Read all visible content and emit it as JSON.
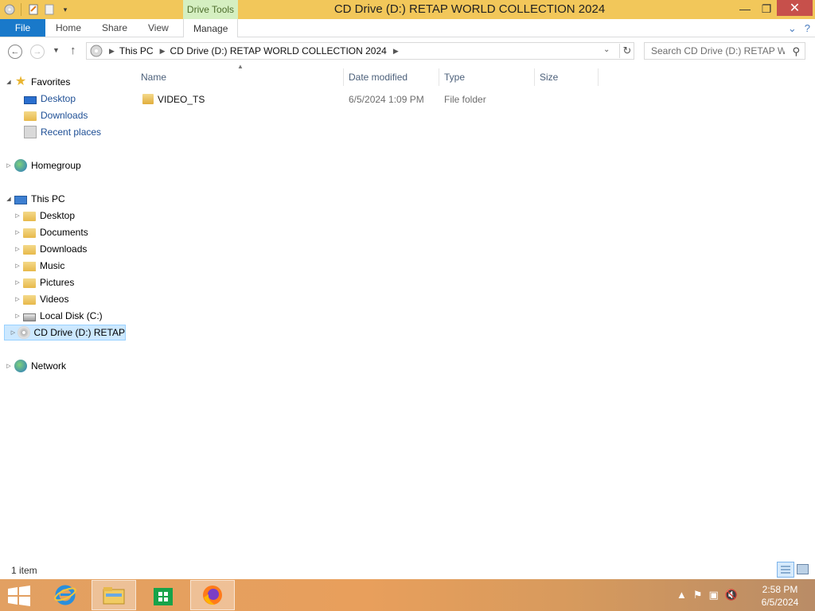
{
  "window": {
    "title": "CD Drive (D:) RETAP WORLD COLLECTION 2024",
    "contextual_tab": "Drive Tools",
    "controls": {
      "minimize": "—",
      "maximize": "❐",
      "close": "✕"
    }
  },
  "ribbon": {
    "file_tab": "File",
    "tabs": [
      "Home",
      "Share",
      "View",
      "Manage"
    ]
  },
  "navigation": {
    "breadcrumbs": [
      "This PC",
      "CD Drive (D:) RETAP WORLD COLLECTION 2024"
    ],
    "search_placeholder": "Search CD Drive (D:) RETAP W..."
  },
  "nav_pane": {
    "favorites": {
      "label": "Favorites",
      "items": [
        "Desktop",
        "Downloads",
        "Recent places"
      ]
    },
    "homegroup": "Homegroup",
    "this_pc": {
      "label": "This PC",
      "items": [
        "Desktop",
        "Documents",
        "Downloads",
        "Music",
        "Pictures",
        "Videos",
        "Local Disk (C:)",
        "CD Drive (D:) RETAP"
      ]
    },
    "network": "Network"
  },
  "file_list": {
    "columns": [
      "Name",
      "Date modified",
      "Type",
      "Size"
    ],
    "rows": [
      {
        "name": "VIDEO_TS",
        "date_modified": "6/5/2024 1:09 PM",
        "type": "File folder",
        "size": ""
      }
    ]
  },
  "status": {
    "item_count": "1 item"
  },
  "taskbar": {
    "apps": [
      "internet-explorer",
      "file-explorer",
      "store",
      "firefox"
    ],
    "clock": {
      "time": "2:58 PM",
      "date": "6/5/2024"
    }
  },
  "colors": {
    "accent": "#1979ca",
    "titlebar": "#f2c75a",
    "contextual_tab": "#d5efc1",
    "close_button": "#c7504b",
    "taskbar": "#e89f5c",
    "selection": "#cce8ff"
  }
}
